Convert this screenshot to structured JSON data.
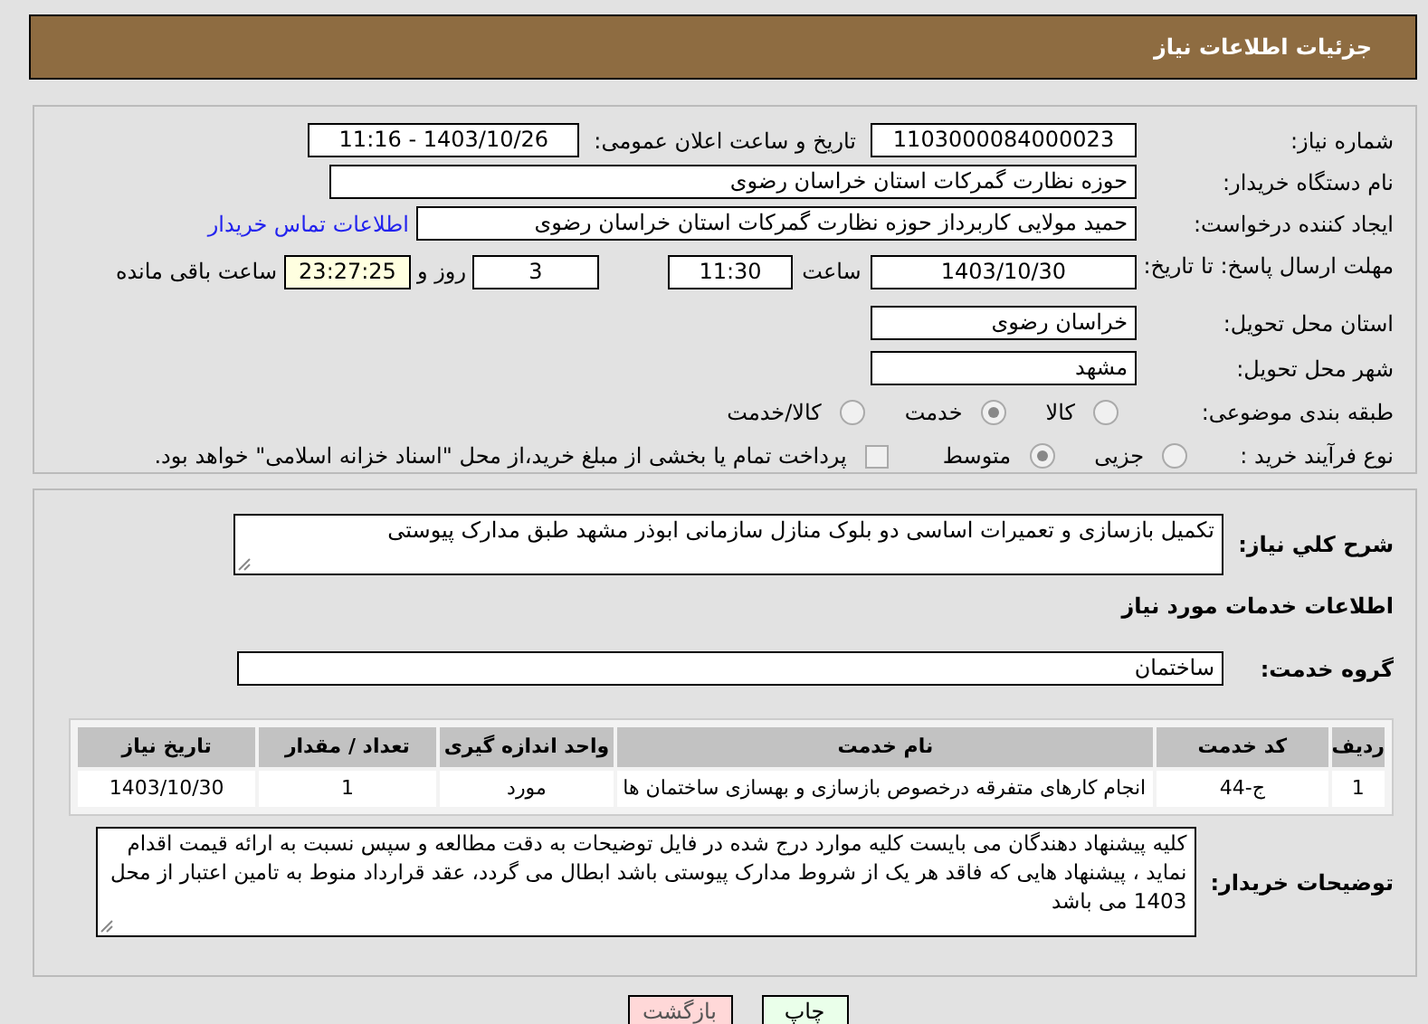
{
  "header": {
    "title": "جزئیات اطلاعات نیاز"
  },
  "need_number": {
    "label": "شماره نیاز:",
    "value": "1103000084000023"
  },
  "announce": {
    "label": "تاریخ و ساعت اعلان عمومی:",
    "value": "1403/10/26 - 11:16"
  },
  "buyer_org": {
    "label": "نام دستگاه خریدار:",
    "value": "حوزه نظارت گمرکات استان خراسان رضوی"
  },
  "creator": {
    "label": "ایجاد کننده درخواست:",
    "value": "حمید مولایی کاربرداز حوزه نظارت گمرکات استان خراسان رضوی",
    "link": "اطلاعات تماس خریدار"
  },
  "deadline": {
    "label": "مهلت ارسال پاسخ: تا تاریخ:",
    "date": "1403/10/30",
    "time_label": "ساعت",
    "time": "11:30",
    "days": "3",
    "days_label": "روز و",
    "remaining": "23:27:25",
    "remaining_label": "ساعت باقی مانده"
  },
  "province": {
    "label": "استان محل تحویل:",
    "value": "خراسان رضوی"
  },
  "city": {
    "label": "شهر محل تحویل:",
    "value": "مشهد"
  },
  "category": {
    "label": "طبقه بندی موضوعی:",
    "options": [
      {
        "label": "کالا",
        "selected": false
      },
      {
        "label": "خدمت",
        "selected": true
      },
      {
        "label": "کالا/خدمت",
        "selected": false
      }
    ]
  },
  "process": {
    "label": "نوع فرآیند خرید :",
    "options": [
      {
        "label": "جزیی",
        "selected": false
      },
      {
        "label": "متوسط",
        "selected": true
      }
    ],
    "payment": {
      "checked": false,
      "text": "پرداخت تمام یا بخشی از مبلغ خرید،از محل \"اسناد خزانه اسلامی\" خواهد بود."
    }
  },
  "description": {
    "label": "شرح کلي نياز:",
    "value": "تکمیل بازسازی و تعمیرات اساسی دو بلوک منازل سازمانی ابوذر مشهد طبق مدارک پیوستی"
  },
  "services_title": "اطلاعات خدمات مورد نیاز",
  "service_group": {
    "label": "گروه خدمت:",
    "value": "ساختمان"
  },
  "table": {
    "columns": [
      "ردیف",
      "کد خدمت",
      "نام خدمت",
      "واحد اندازه گیری",
      "تعداد / مقدار",
      "تاریخ نیاز"
    ],
    "rows": [
      [
        "1",
        "ج-44",
        "انجام کارهای متفرقه درخصوص بازسازی و بهسازی ساختمان ها",
        "مورد",
        "1",
        "1403/10/30"
      ]
    ]
  },
  "notes": {
    "label": "توضیحات خریدار:",
    "value": "کلیه پیشنهاد دهندگان می بایست کلیه موارد درج شده در فایل توضیحات به دقت مطالعه و سپس نسبت به ارائه قیمت اقدام نماید ، پیشنهاد هایی که فاقد هر یک از شروط مدارک پیوستی باشد ابطال می گردد، عقد قرارداد منوط به تامین اعتبار از محل 1403 می باشد"
  },
  "buttons": [
    {
      "label": "چاپ",
      "kind": "print"
    },
    {
      "label": "بازگشت",
      "kind": "back"
    }
  ]
}
